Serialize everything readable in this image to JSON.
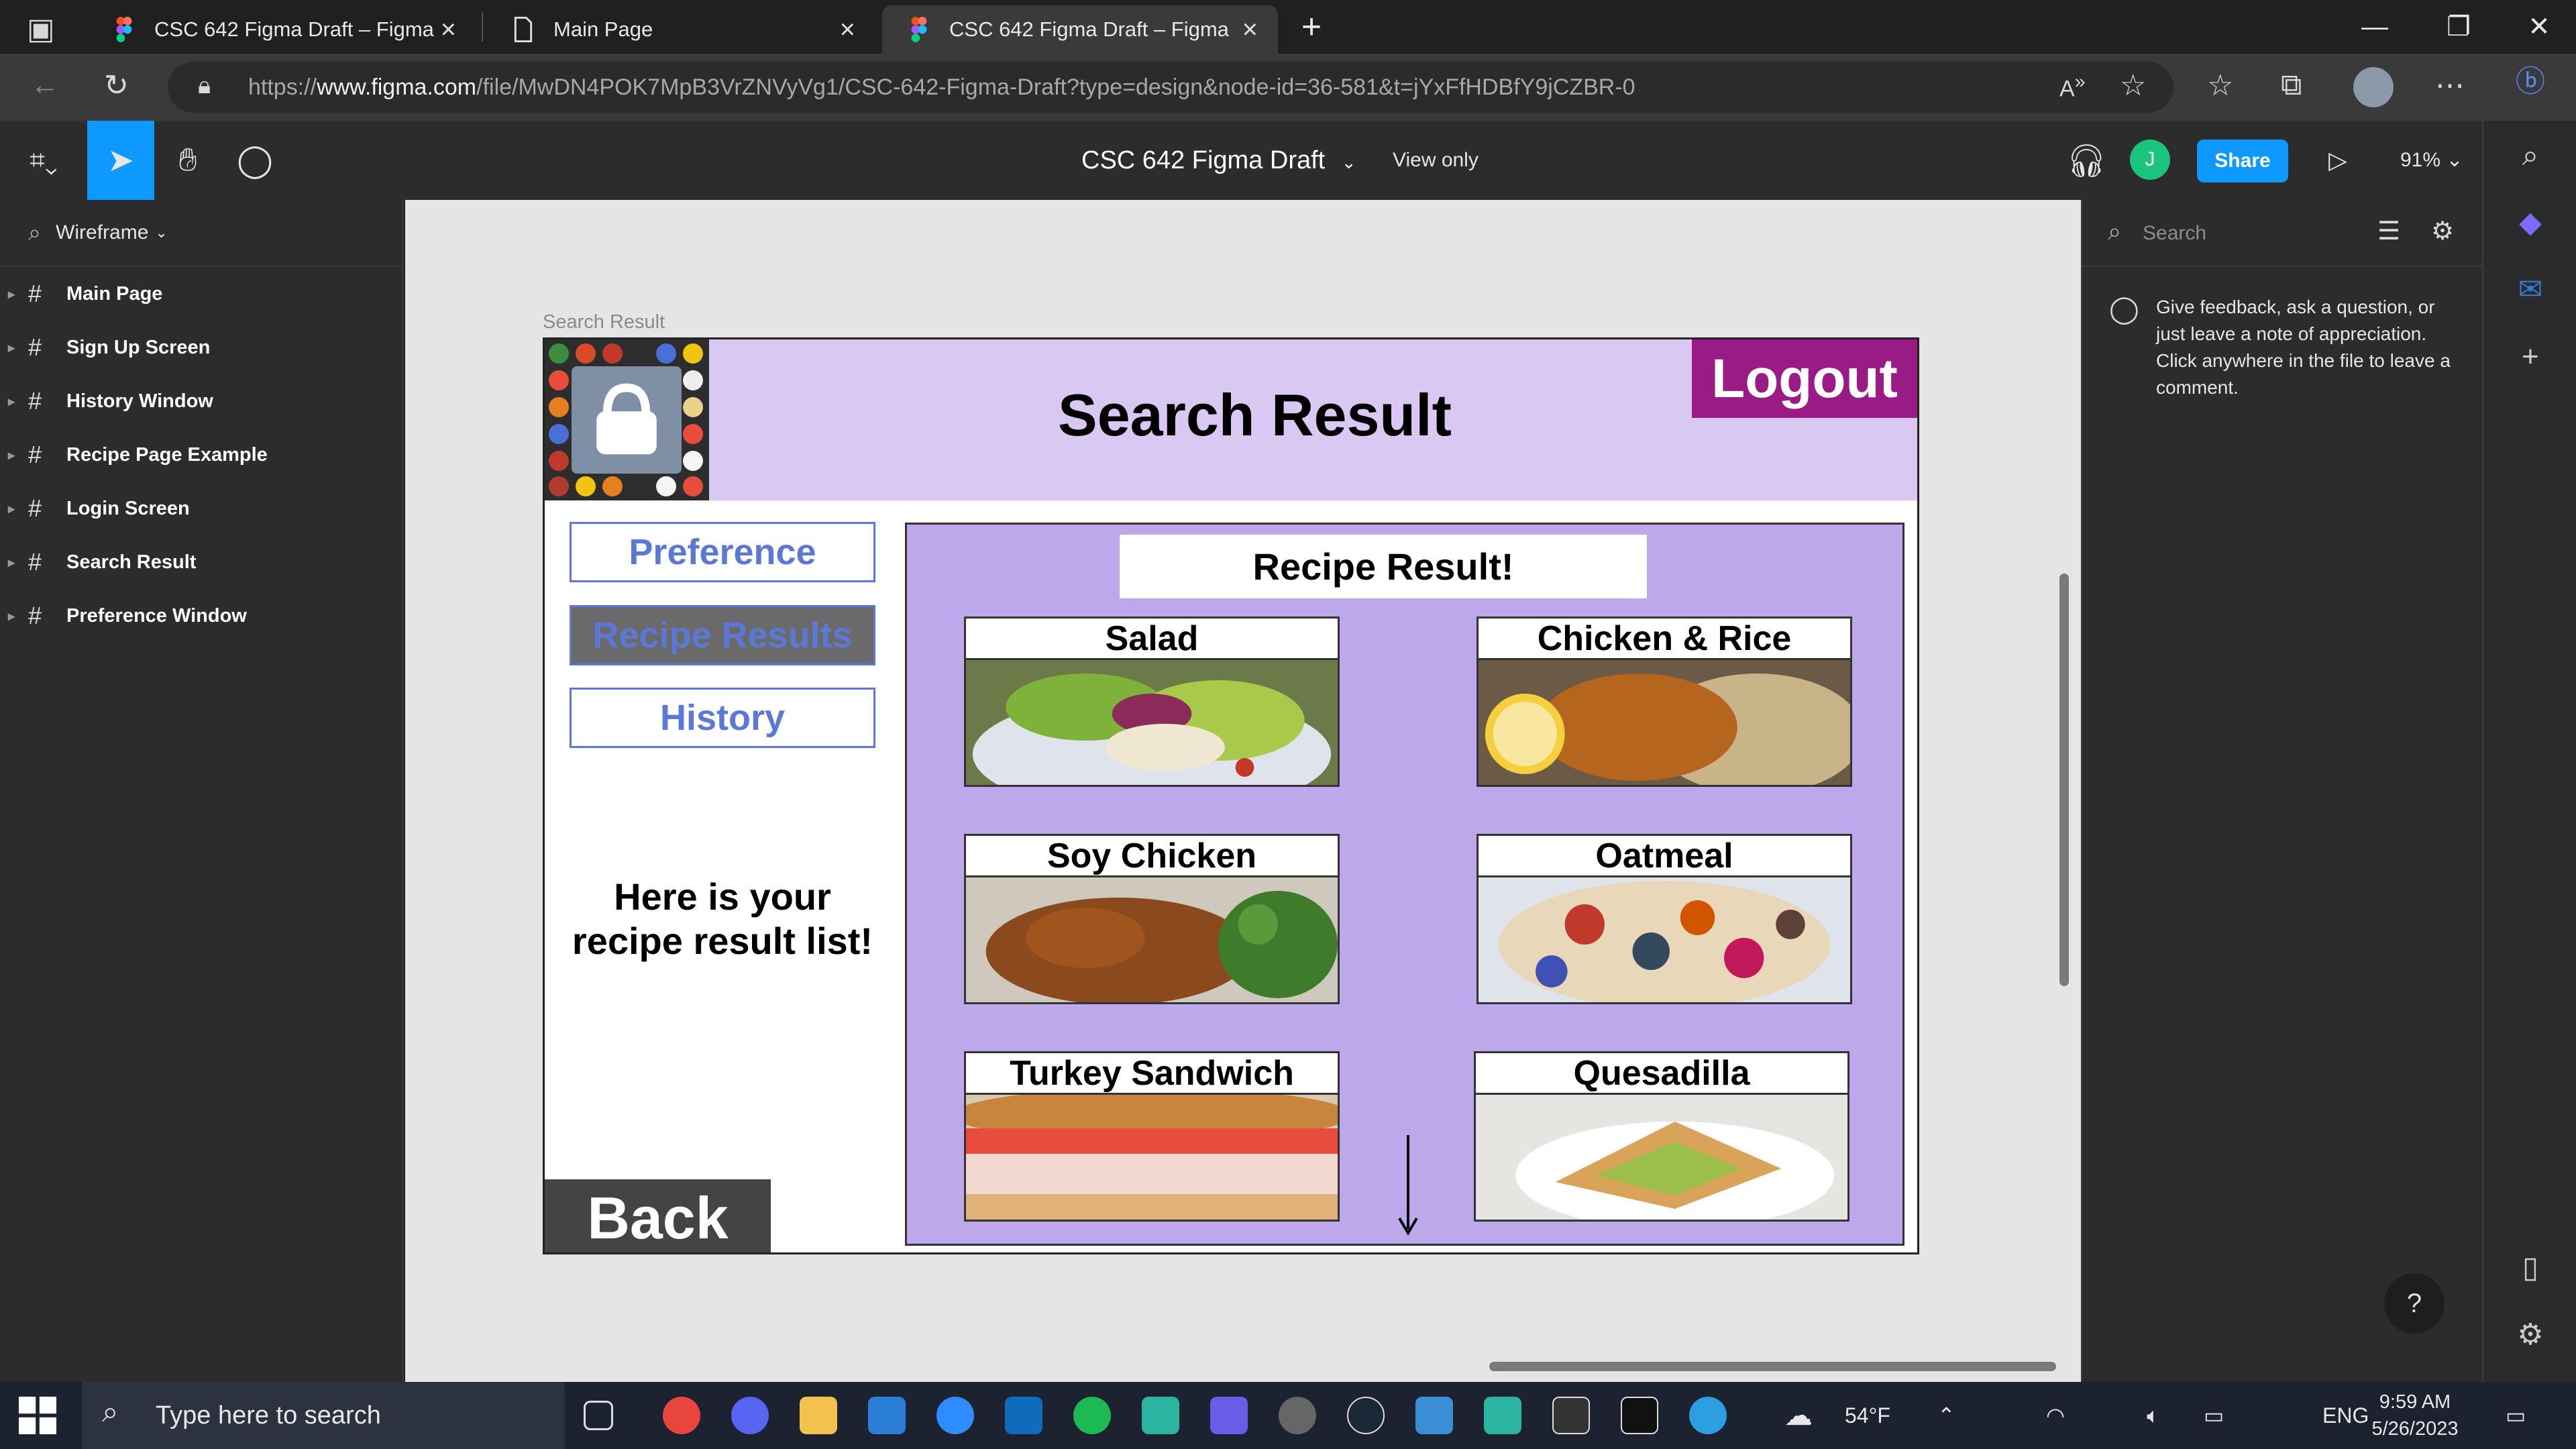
{
  "browser": {
    "tabs": [
      {
        "label": "CSC 642 Figma Draft – Figma",
        "active": false
      },
      {
        "label": "Main Page",
        "active": false
      },
      {
        "label": "CSC 642 Figma Draft – Figma",
        "active": true
      }
    ],
    "new_tab": "+",
    "url_prefix": "https://",
    "url_domain": "www.figma.com",
    "url_path": "/file/MwDN4POK7MpB3VrZNVyVg1/CSC-642-Figma-Draft?type=design&node-id=36-581&t=jYxFfHDBfY9jCZBR-0"
  },
  "figma": {
    "file_title": "CSC 642 Figma Draft",
    "view_only": "View only",
    "avatar_initial": "J",
    "share_label": "Share",
    "zoom": "91%"
  },
  "layers": {
    "page_name": "Wireframe",
    "items": [
      {
        "label": "Main Page"
      },
      {
        "label": "Sign Up Screen"
      },
      {
        "label": "History Window"
      },
      {
        "label": "Recipe Page Example"
      },
      {
        "label": "Login Screen"
      },
      {
        "label": "Search Result"
      },
      {
        "label": "Preference Window"
      }
    ]
  },
  "frame": {
    "label": "Search Result",
    "title": "Search Result",
    "logout": "Logout",
    "nav": [
      {
        "label": "Preference",
        "selected": false
      },
      {
        "label": "Recipe Results",
        "selected": true
      },
      {
        "label": "History",
        "selected": false
      }
    ],
    "side_text": "Here is your recipe result list!",
    "back": "Back",
    "results_title": "Recipe Result!",
    "cards": [
      {
        "title": "Salad"
      },
      {
        "title": "Chicken & Rice"
      },
      {
        "title": "Soy Chicken"
      },
      {
        "title": "Oatmeal"
      },
      {
        "title": "Turkey Sandwich"
      },
      {
        "title": "Quesadilla"
      }
    ]
  },
  "right_panel": {
    "search_placeholder": "Search",
    "comment_hint": "Give feedback, ask a question, or just leave a note of appreciation. Click anywhere in the file to leave a comment.",
    "help": "?"
  },
  "taskbar": {
    "search_placeholder": "Type here to search",
    "weather": "54°F",
    "language": "ENG",
    "time": "9:59 AM",
    "date": "5/26/2023"
  }
}
